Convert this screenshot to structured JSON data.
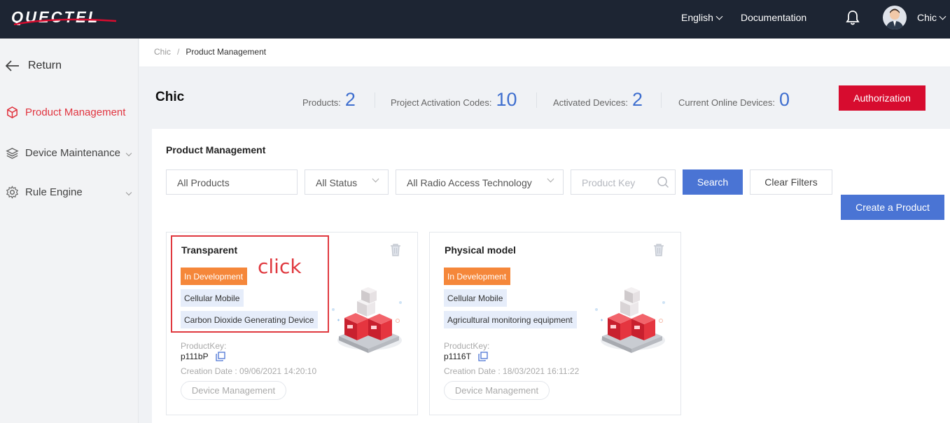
{
  "header": {
    "brand": "QUECTEL",
    "language": "English",
    "documentation": "Documentation",
    "user": "Chic",
    "icons": [
      "bell-icon",
      "avatar",
      "chevron-down-icon"
    ]
  },
  "sidebar": {
    "return_label": "Return",
    "items": [
      {
        "label": "Product Management",
        "icon": "cube-icon",
        "active": true
      },
      {
        "label": "Device Maintenance",
        "icon": "layers-icon",
        "active": false
      },
      {
        "label": "Rule Engine",
        "icon": "gear-icon",
        "active": false
      }
    ]
  },
  "breadcrumb": {
    "root": "Chic",
    "separator": "/",
    "current": "Product Management"
  },
  "overview": {
    "title": "Chic",
    "stats": [
      {
        "label": "Products:",
        "value": "2"
      },
      {
        "label": "Project Activation Codes:",
        "value": "10"
      },
      {
        "label": "Activated Devices:",
        "value": "2"
      },
      {
        "label": "Current Online Devices:",
        "value": "0"
      }
    ],
    "authorization_label": "Authorization"
  },
  "filters": {
    "section_title": "Product Management",
    "products": "All Products",
    "status": "All Status",
    "rat": "All Radio Access Technology",
    "product_key_placeholder": "Product Key",
    "search_label": "Search",
    "clear_label": "Clear Filters",
    "create_label": "Create a Product"
  },
  "cards": [
    {
      "name": "Transparent",
      "status": "In Development",
      "network": "Cellular Mobile",
      "category": "Carbon Dioxide Generating Device",
      "product_key_label": "ProductKey:",
      "product_key": "p111bP",
      "creation_date": "Creation Date : 09/06/2021 14:20:10",
      "action_label": "Device Management"
    },
    {
      "name": "Physical model",
      "status": "In Development",
      "network": "Cellular Mobile",
      "category": "Agricultural monitoring equipment",
      "product_key_label": "ProductKey:",
      "product_key": "p1116T",
      "creation_date": "Creation Date : 18/03/2021 16:11:22",
      "action_label": "Device Management"
    }
  ],
  "annotation": {
    "text": "click"
  },
  "colors": {
    "topbar": "#1d2533",
    "accent_red": "#d70c2f",
    "primary_blue": "#4a74d4",
    "stat_blue": "#3f6fcf",
    "dev_orange": "#f5873a",
    "tag_blue": "#e6edfa",
    "annotation_red": "#e0393f"
  }
}
